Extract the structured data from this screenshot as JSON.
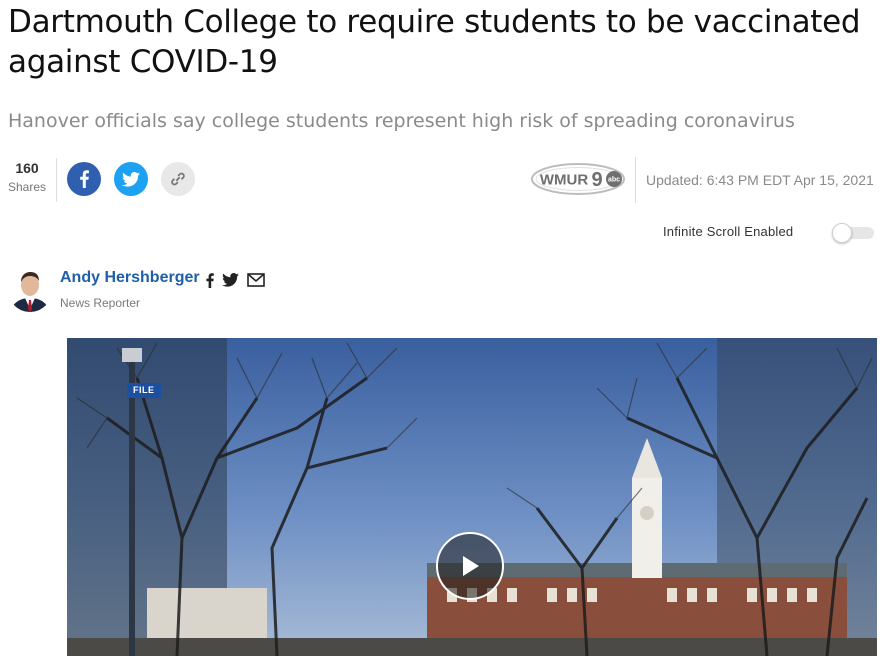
{
  "article": {
    "headline": "Dartmouth College to require students to be vaccinated against COVID-19",
    "subheadline": "Hanover officials say college students represent high risk of spreading coronavirus",
    "updated": "Updated: 6:43 PM EDT Apr 15, 2021"
  },
  "share": {
    "count": "160",
    "label": "Shares",
    "buttons": [
      {
        "name": "facebook",
        "icon": "facebook-icon"
      },
      {
        "name": "twitter",
        "icon": "twitter-icon"
      },
      {
        "name": "copy-link",
        "icon": "link-icon"
      }
    ]
  },
  "station_logo": {
    "text": "WMUR",
    "channel": "9",
    "network": "abc"
  },
  "infinite_scroll": {
    "label": "Infinite Scroll Enabled",
    "enabled": false
  },
  "author": {
    "name": "Andy Hershberger",
    "role": "News Reporter",
    "icons": [
      "facebook-icon",
      "twitter-icon",
      "email-icon"
    ]
  },
  "video": {
    "badge": "FILE",
    "play_icon": "play-icon"
  },
  "colors": {
    "facebook": "#2f5faf",
    "twitter": "#1da1f2",
    "author_link": "#1f5fa8",
    "file_badge": "#1d4fa0"
  }
}
